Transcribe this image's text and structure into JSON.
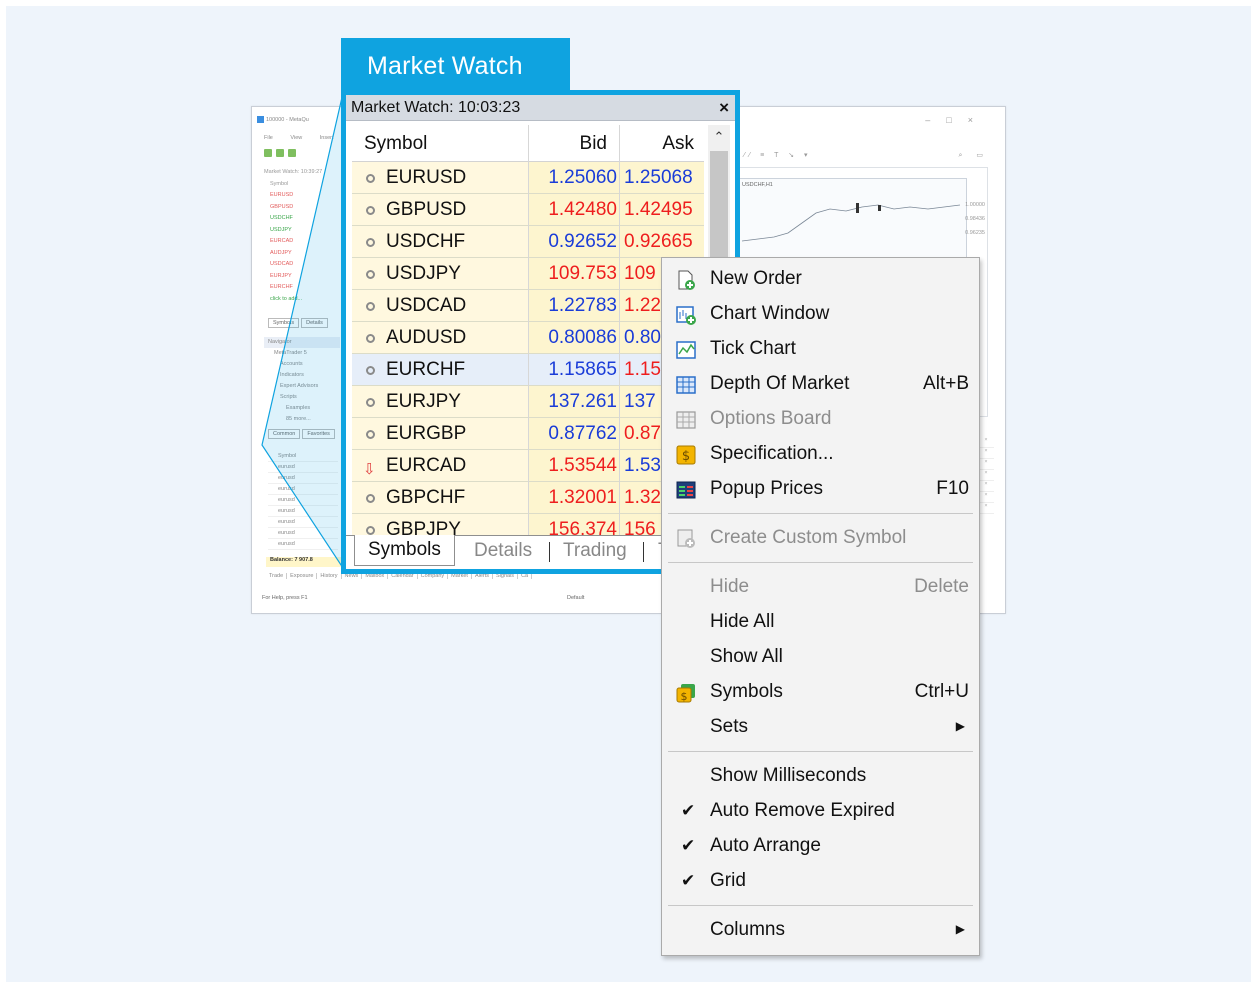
{
  "callout": {
    "title": "Market Watch"
  },
  "background_window": {
    "title": "100000 - MetaQu",
    "menu": [
      "File",
      "View",
      "Insert"
    ],
    "mini_symbols": [
      "Symbol",
      "EURUSD",
      "GBPUSD",
      "USDCHF",
      "USDJPY",
      "EURCAD",
      "AUDJPY",
      "USDCAD",
      "EURJPY",
      "EURCHF",
      "click to add..."
    ],
    "mini_title": "Market Watch: 10:39:27",
    "mini_tabs": [
      "Symbols",
      "Details"
    ],
    "navigator": [
      "Navigator",
      "MetaTrader 5",
      "Accounts",
      "Indicators",
      "Expert Advisors",
      "Scripts",
      "Examples",
      "85 more..."
    ],
    "nav_tabs": [
      "Common",
      "Favorites"
    ],
    "trade_rows": [
      "Symbol",
      "eurusd",
      "eurusd",
      "eurusd",
      "eurusd",
      "eurusd",
      "eurusd",
      "eurusd",
      "eurusd"
    ],
    "balance": "Balance: 7 907.8",
    "bottom_tabs": [
      "Trade",
      "Exposure",
      "History",
      "News",
      "Mailbox",
      "Calendar",
      "Company",
      "Market",
      "Alerts",
      "Signals",
      "Ca"
    ],
    "status_help": "For Help, press F1",
    "status_default": "Default",
    "chart_title": "USDCHF,H1",
    "chart_price_labels": [
      "1.00000",
      "0.98436",
      "0.96235"
    ]
  },
  "market_watch": {
    "title": "Market Watch: 10:03:23",
    "close_glyph": "×",
    "headers": {
      "symbol": "Symbol",
      "bid": "Bid",
      "ask": "Ask"
    },
    "rows": [
      {
        "symbol": "EURUSD",
        "bid": "1.25060",
        "ask": "1.25068",
        "color": "blue",
        "icon": "dot"
      },
      {
        "symbol": "GBPUSD",
        "bid": "1.42480",
        "ask": "1.42495",
        "color": "red",
        "icon": "dot"
      },
      {
        "symbol": "USDCHF",
        "bid": "0.92652",
        "ask": "0.92665",
        "color": "blue",
        "ask_color": "red",
        "icon": "dot"
      },
      {
        "symbol": "USDJPY",
        "bid": "109.753",
        "ask": "109",
        "color": "red",
        "icon": "dot"
      },
      {
        "symbol": "USDCAD",
        "bid": "1.22783",
        "ask": "1.22",
        "color": "blue",
        "ask_color": "red",
        "icon": "dot"
      },
      {
        "symbol": "AUDUSD",
        "bid": "0.80086",
        "ask": "0.80",
        "color": "blue",
        "icon": "dot"
      },
      {
        "symbol": "EURCHF",
        "bid": "1.15865",
        "ask": "1.15",
        "color": "blue",
        "ask_color": "red",
        "icon": "dot",
        "selected": true
      },
      {
        "symbol": "EURJPY",
        "bid": "137.261",
        "ask": "137",
        "color": "blue",
        "icon": "dot"
      },
      {
        "symbol": "EURGBP",
        "bid": "0.87762",
        "ask": "0.87",
        "color": "blue",
        "ask_color": "red",
        "icon": "dot"
      },
      {
        "symbol": "EURCAD",
        "bid": "1.53544",
        "ask": "1.53",
        "color": "red",
        "ask_color": "blue",
        "icon": "arrow-down"
      },
      {
        "symbol": "GBPCHF",
        "bid": "1.32001",
        "ask": "1.32",
        "color": "red",
        "icon": "dot"
      },
      {
        "symbol": "GBPJPY",
        "bid": "156.374",
        "ask": "156",
        "color": "red",
        "icon": "dot"
      }
    ],
    "tabs": [
      "Symbols",
      "Details",
      "Trading",
      "T"
    ]
  },
  "context_menu": {
    "groups": [
      [
        {
          "label": "New Order",
          "icon": "new-order-icon",
          "enabled": true
        },
        {
          "label": "Chart Window",
          "icon": "chart-window-icon",
          "enabled": true
        },
        {
          "label": "Tick Chart",
          "icon": "tick-chart-icon",
          "enabled": true
        },
        {
          "label": "Depth Of Market",
          "shortcut": "Alt+B",
          "icon": "depth-of-market-icon",
          "enabled": true
        },
        {
          "label": "Options Board",
          "icon": "options-board-icon",
          "enabled": false
        },
        {
          "label": "Specification...",
          "icon": "specification-icon",
          "enabled": true
        },
        {
          "label": "Popup Prices",
          "shortcut": "F10",
          "icon": "popup-prices-icon",
          "enabled": true
        }
      ],
      [
        {
          "label": "Create Custom Symbol",
          "icon": "custom-symbol-icon",
          "enabled": false
        }
      ],
      [
        {
          "label": "Hide",
          "shortcut": "Delete",
          "enabled": false
        },
        {
          "label": "Hide All",
          "enabled": true
        },
        {
          "label": "Show All",
          "enabled": true
        },
        {
          "label": "Symbols",
          "shortcut": "Ctrl+U",
          "icon": "symbols-icon",
          "enabled": true
        },
        {
          "label": "Sets",
          "submenu": true,
          "enabled": true
        }
      ],
      [
        {
          "label": "Show Milliseconds",
          "enabled": true,
          "checked": false
        },
        {
          "label": "Auto Remove Expired",
          "enabled": true,
          "checked": true
        },
        {
          "label": "Auto Arrange",
          "enabled": true,
          "checked": true
        },
        {
          "label": "Grid",
          "enabled": true,
          "checked": true
        }
      ],
      [
        {
          "label": "Columns",
          "submenu": true,
          "enabled": true
        }
      ]
    ]
  },
  "colors": {
    "accent": "#0fa3e0",
    "row_bg": "#fdf5cf",
    "row_bg_selected": "#e6eef9",
    "bid_blue": "#1a3cd8",
    "ask_red": "#ee1e1e"
  }
}
